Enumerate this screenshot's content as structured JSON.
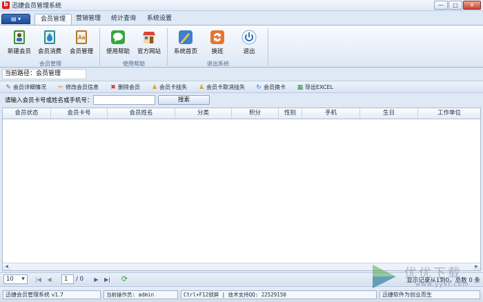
{
  "window": {
    "title": "迅捷会员管理系统",
    "logo_letter": "b"
  },
  "ribbon": {
    "menu_label": "▤ ▾",
    "tabs": [
      {
        "label": "会员管理",
        "active": true
      },
      {
        "label": "营销管理",
        "active": false
      },
      {
        "label": "统计查询",
        "active": false
      },
      {
        "label": "系统设置",
        "active": false
      }
    ],
    "buttons": [
      {
        "label": "新建会员",
        "icon": "new-member-icon"
      },
      {
        "label": "会员消费",
        "icon": "member-consume-icon"
      },
      {
        "label": "会员管理",
        "icon": "member-manage-icon"
      },
      {
        "label": "使用帮助",
        "icon": "help-icon"
      },
      {
        "label": "官方网站",
        "icon": "website-icon"
      },
      {
        "label": "系统首页",
        "icon": "home-icon"
      },
      {
        "label": "换班",
        "icon": "shift-icon"
      },
      {
        "label": "退出",
        "icon": "power-icon"
      }
    ],
    "groups": [
      "会员管理",
      "使用帮助",
      "退出系统"
    ]
  },
  "path": {
    "text": "当前路径：会员管理"
  },
  "toolbar": {
    "items": [
      {
        "label": "会员详细情况",
        "icon": "wrench-icon"
      },
      {
        "label": "修改会员信息",
        "icon": "pencil-icon"
      },
      {
        "label": "删除会员",
        "icon": "delete-icon"
      },
      {
        "label": "会员卡挂失",
        "icon": "user-lock-icon"
      },
      {
        "label": "会员卡取消挂失",
        "icon": "user-unlock-icon"
      },
      {
        "label": "会员换卡",
        "icon": "swap-card-icon"
      },
      {
        "label": "导出EXCEL",
        "icon": "excel-icon"
      }
    ]
  },
  "search": {
    "label": "请输入会员卡号或姓名或手机号：",
    "value": "",
    "button": "搜索"
  },
  "grid": {
    "columns": [
      "会员状态",
      "会员卡号",
      "会员姓名",
      "分类",
      "积分",
      "性别",
      "手机",
      "生日",
      "工作单位"
    ],
    "rows": []
  },
  "pager": {
    "page_size": "10",
    "current_page": "1",
    "total_pages": "/ 0",
    "record_info": "显示记录从1到0，总数 0 条"
  },
  "status": {
    "version": "迅捷会员管理系统 v1.7",
    "operator": "当前操作员: admin",
    "hotkey": "Ctrl+F12锁屏 | 技术支持QQ: 22529150",
    "slogan": "迅捷软件为创业而生"
  },
  "watermark": {
    "text": "优优下载",
    "url": "www.yyxt.com"
  },
  "colors": {
    "accent": "#1d4a93",
    "close": "#c8442c",
    "grid_border": "#a9bbd4"
  }
}
